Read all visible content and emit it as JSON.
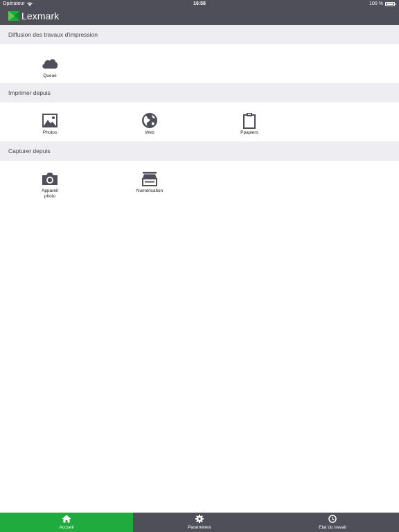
{
  "status_bar": {
    "carrier": "Opérateur",
    "time": "16:58",
    "battery": "100 %"
  },
  "app": {
    "logo_text": "Lexmark",
    "brand_color": "#1fab3e",
    "header_color": "#4f4f5a"
  },
  "sections": [
    {
      "title": "Diffusion des travaux d'impression",
      "items": [
        {
          "label": "Queue",
          "icon": "cloud-icon"
        }
      ]
    },
    {
      "title": "Imprimer depuis",
      "items": [
        {
          "label": "Photos",
          "icon": "photo-icon"
        },
        {
          "label": "Web",
          "icon": "globe-icon"
        },
        {
          "label": "Ppapiers",
          "icon": "clipboard-icon"
        }
      ]
    },
    {
      "title": "Capturer depuis",
      "items": [
        {
          "label": "Appareil photo",
          "icon": "camera-icon"
        },
        {
          "label": "Numérisation",
          "icon": "scanner-icon"
        }
      ]
    }
  ],
  "tabbar": {
    "items": [
      {
        "label": "Accueil",
        "icon": "home-icon",
        "active": true
      },
      {
        "label": "Paramètres",
        "icon": "gear-icon",
        "active": false
      },
      {
        "label": "Etat du travail",
        "icon": "job-status-icon",
        "active": false
      }
    ]
  }
}
